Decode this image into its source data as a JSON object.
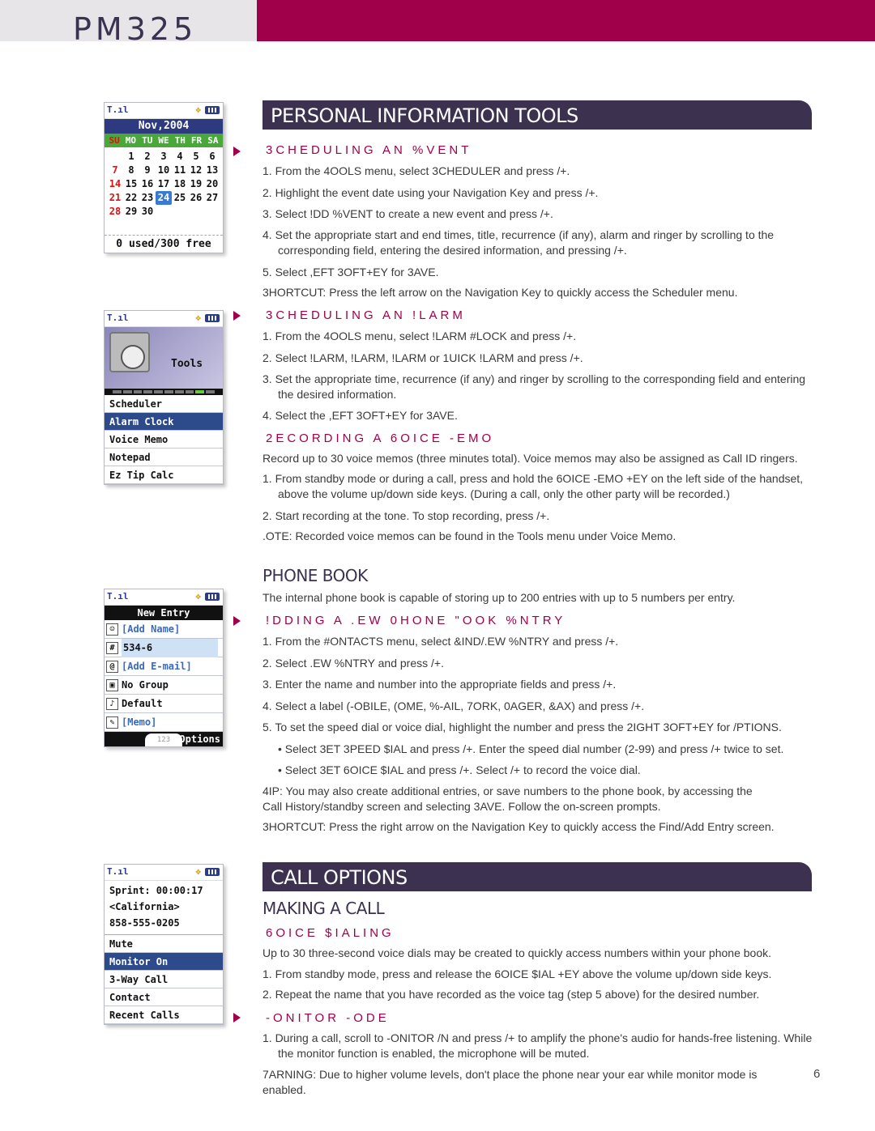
{
  "header": {
    "model": "PM325",
    "colors": {
      "brand": "#a0004a",
      "dark": "#3c3250",
      "header_bg": "#e7e5e8"
    }
  },
  "phones": {
    "calendar": {
      "month": "Nov,2004",
      "days": [
        "SU",
        "MO",
        "TU",
        "WE",
        "TH",
        "FR",
        "SA"
      ],
      "weeks": [
        [
          "",
          "1",
          "2",
          "3",
          "4",
          "5",
          "6"
        ],
        [
          "7",
          "8",
          "9",
          "10",
          "11",
          "12",
          "13"
        ],
        [
          "14",
          "15",
          "16",
          "17",
          "18",
          "19",
          "20"
        ],
        [
          "21",
          "22",
          "23",
          "24",
          "25",
          "26",
          "27"
        ],
        [
          "28",
          "29",
          "30",
          "",
          "",
          "",
          ""
        ]
      ],
      "today": "24",
      "footer": "0 used/300 free"
    },
    "tools": {
      "title": "Tools",
      "items": [
        "Scheduler",
        "Alarm Clock",
        "Voice Memo",
        "Notepad",
        "Ez Tip Calc"
      ],
      "selected": "Alarm Clock"
    },
    "new_entry": {
      "title": "New Entry",
      "rows": [
        {
          "icon": "person-icon",
          "text": "[Add Name]"
        },
        {
          "icon": "number-icon",
          "text": "534-6"
        },
        {
          "icon": "email-icon",
          "text": "[Add E-mail]"
        },
        {
          "icon": "group-icon",
          "text": "No Group"
        },
        {
          "icon": "bell-icon",
          "text": "Default"
        },
        {
          "icon": "memo-icon",
          "text": "[Memo]"
        }
      ],
      "mode": "123",
      "softkey": "Options"
    },
    "in_call": {
      "lines": [
        "Sprint: 00:00:17",
        "<California>",
        "858-555-0205"
      ],
      "items": [
        "Mute",
        "Monitor On",
        "3-Way Call",
        "Contact",
        "Recent Calls"
      ],
      "selected": "Monitor On"
    }
  },
  "sections": {
    "pit": {
      "banner": "PERSONAL INFORMATION TOOLS",
      "event": {
        "heading": "3CHEDULING AN %VENT",
        "steps": [
          "1. From the 4OOLS menu, select 3CHEDULER and press /+.",
          "2. Highlight the event date using your Navigation Key and press /+.",
          "3. Select !DD %VENT to create a new event and press /+.",
          "4. Set the appropriate start and end times, title, recurrence (if any), alarm and ringer by scrolling to the corresponding field, entering the desired information, and pressing /+.",
          "5. Select ,EFT 3OFT+EY for 3AVE."
        ],
        "shortcut": "3HORTCUT: Press the left arrow on the Navigation Key to quickly access the Scheduler menu."
      },
      "alarm": {
        "heading": "3CHEDULING AN !LARM",
        "steps": [
          "1. From the 4OOLS menu, select !LARM #LOCK and press /+.",
          "2. Select !LARM, !LARM, !LARM or 1UICK !LARM and press /+.",
          "3. Set the appropriate time, recurrence (if any) and ringer by scrolling to the corresponding field and entering the desired information.",
          "4. Select the ,EFT 3OFT+EY for 3AVE."
        ]
      },
      "memo": {
        "heading": "2ECORDING A 6OICE -EMO",
        "intro": "Record up to 30 voice memos (three minutes total). Voice memos may also be assigned as Call ID ringers.",
        "steps": [
          "1. From standby mode or during a call, press and hold the 6OICE -EMO +EY on the left side of the handset, above the volume up/down side keys. (During a call, only the other party will be recorded.)",
          "2. Start recording at the tone. To stop recording, press /+."
        ],
        "note": ".OTE: Recorded voice memos can be found in the Tools menu under Voice Memo."
      }
    },
    "phonebook": {
      "heading": "PHONE BOOK",
      "intro": "The internal phone book is capable of storing up to 200 entries with up to 5 numbers per entry.",
      "add": {
        "heading": "!DDING A .EW 0HONE \"OOK %NTRY",
        "steps": [
          "1. From the #ONTACTS menu, select &IND/.EW %NTRY and press /+.",
          "2. Select .EW %NTRY and press /+.",
          "3. Enter the name and number into the appropriate fields and press /+.",
          "4. Select a label (-OBILE, (OME, %-AIL, 7ORK, 0AGER, &AX) and press /+.",
          "5. To set the speed dial or voice dial, highlight the number and press the 2IGHT 3OFT+EY for /PTIONS."
        ],
        "bullets": [
          "• Select 3ET 3PEED $IAL and press /+. Enter the speed dial number (2-99) and press /+ twice to set.",
          "• Select 3ET 6OICE $IAL and press /+. Select /+ to record the voice dial."
        ],
        "tip": "4IP: You may also create additional entries, or save numbers to the phone book, by accessing the Call History/standby screen and selecting 3AVE. Follow the on-screen prompts.",
        "shortcut": "3HORTCUT: Press the right arrow on the Navigation Key to quickly access the Find/Add Entry screen."
      }
    },
    "call": {
      "banner": "CALL OPTIONS",
      "heading": "MAKING A CALL",
      "voice": {
        "heading": "6OICE $IALING",
        "intro": "Up to 30 three-second voice dials may be created to quickly access numbers within your phone book.",
        "steps": [
          "1. From standby mode, press and release the 6OICE $IAL +EY above the volume up/down side keys.",
          "2. Repeat the name that you have recorded as the voice tag (step 5 above) for the desired number."
        ]
      },
      "monitor": {
        "heading": "-ONITOR -ODE",
        "steps": [
          "1. During a call, scroll to -ONITOR /N and press /+ to amplify the phone's audio for hands-free listening. While the monitor function is enabled, the microphone will be muted."
        ],
        "warning": "7ARNING: Due to higher volume levels, don't place the phone near your ear while monitor mode is enabled."
      }
    }
  },
  "page_number": "6"
}
